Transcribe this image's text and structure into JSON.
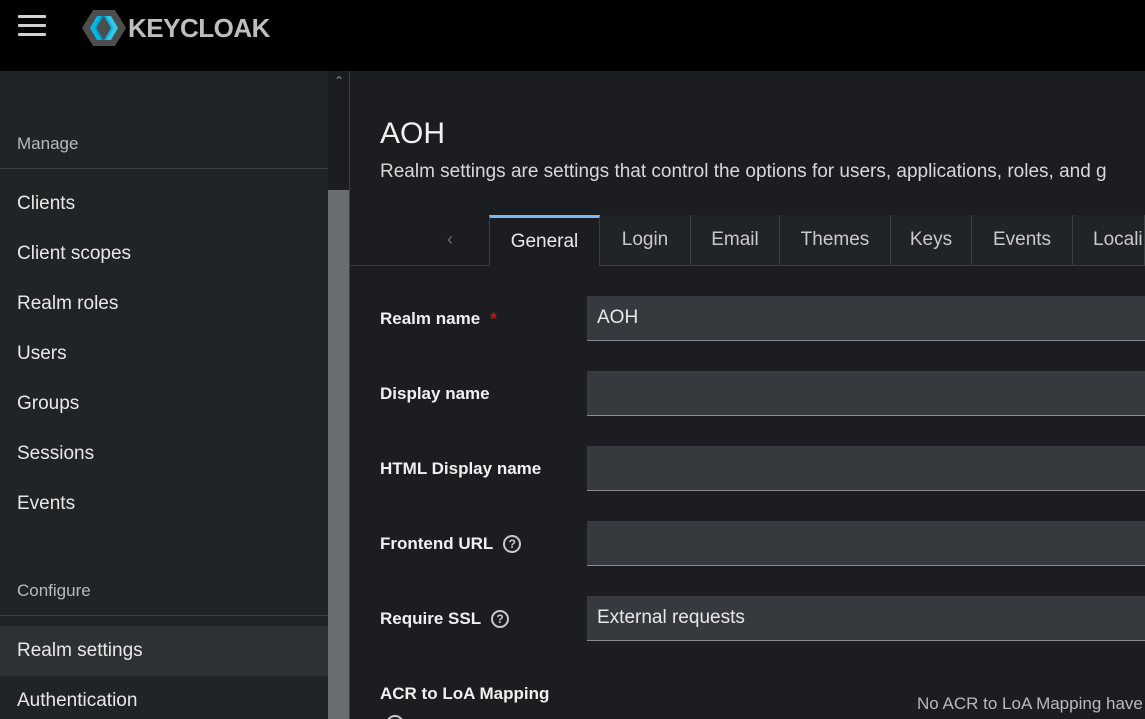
{
  "header": {
    "brand": "KEYCLOAK",
    "brand_colors": {
      "outer": "#4d4d4d",
      "inner_light": "#00b8e3",
      "inner_dark": "#33c6e9"
    }
  },
  "sidebar": {
    "sections": [
      {
        "label": "Manage"
      },
      {
        "label": "Configure"
      }
    ],
    "items": [
      {
        "label": "Clients"
      },
      {
        "label": "Client scopes"
      },
      {
        "label": "Realm roles"
      },
      {
        "label": "Users"
      },
      {
        "label": "Groups"
      },
      {
        "label": "Sessions"
      },
      {
        "label": "Events"
      },
      {
        "label": "Realm settings",
        "active": true
      },
      {
        "label": "Authentication"
      }
    ]
  },
  "main": {
    "title": "AOH",
    "description": "Realm settings are settings that control the options for users, applications, roles, and g",
    "tabs": [
      {
        "label": "General",
        "active": true
      },
      {
        "label": "Login"
      },
      {
        "label": "Email"
      },
      {
        "label": "Themes"
      },
      {
        "label": "Keys"
      },
      {
        "label": "Events"
      },
      {
        "label": "Locali"
      }
    ],
    "form": {
      "realm_name": {
        "label": "Realm name",
        "required_mark": "*",
        "value": "AOH"
      },
      "display_name": {
        "label": "Display name",
        "value": ""
      },
      "html_display_name": {
        "label": "HTML Display name",
        "value": ""
      },
      "frontend_url": {
        "label": "Frontend URL",
        "help": "?",
        "value": ""
      },
      "require_ssl": {
        "label": "Require SSL",
        "help": "?",
        "value": "External requests"
      },
      "acr_loa": {
        "label": "ACR to LoA Mapping",
        "empty_note": "No ACR to LoA Mapping have"
      }
    }
  }
}
